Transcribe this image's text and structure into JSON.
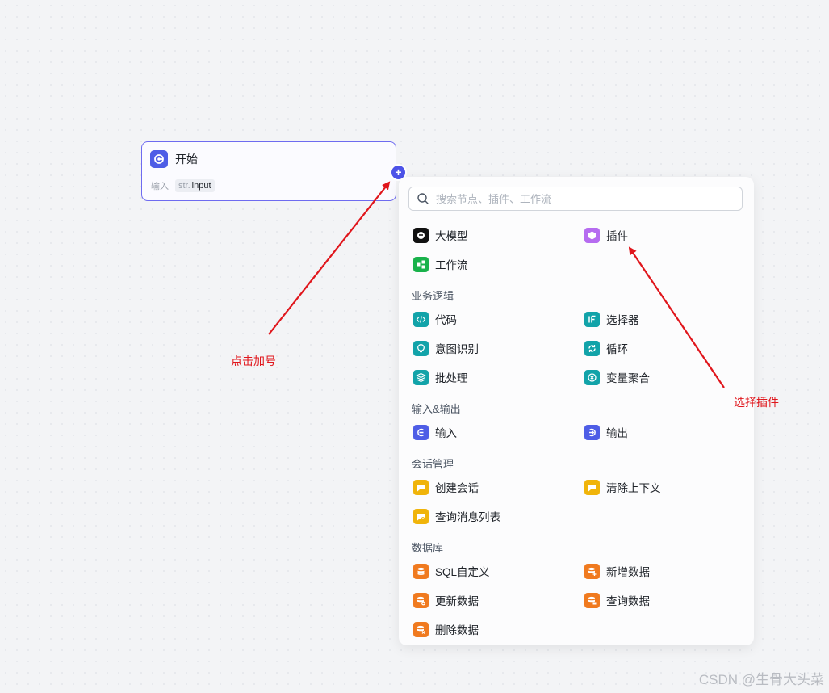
{
  "start_node": {
    "title": "开始",
    "io_label": "输入",
    "param_type": "str.",
    "param_name": "input"
  },
  "add_button": {
    "symbol": "+"
  },
  "search": {
    "placeholder": "搜索节点、插件、工作流"
  },
  "top_items": [
    {
      "label": "大模型",
      "icon": "llm-icon",
      "color": "#111111"
    },
    {
      "label": "插件",
      "icon": "plugin-icon",
      "color": "#b66cf0"
    },
    {
      "label": "工作流",
      "icon": "workflow-icon",
      "color": "#19b24b"
    }
  ],
  "sections": [
    {
      "title": "业务逻辑",
      "items": [
        {
          "label": "代码",
          "icon": "code-icon",
          "color": "#12a3a9"
        },
        {
          "label": "选择器",
          "icon": "if-selector-icon",
          "color": "#12a3a9"
        },
        {
          "label": "意图识别",
          "icon": "intent-icon",
          "color": "#12a3a9"
        },
        {
          "label": "循环",
          "icon": "loop-icon",
          "color": "#12a3a9"
        },
        {
          "label": "批处理",
          "icon": "batch-icon",
          "color": "#12a3a9"
        },
        {
          "label": "变量聚合",
          "icon": "variable-merge-icon",
          "color": "#12a3a9"
        }
      ]
    },
    {
      "title": "输入&输出",
      "items": [
        {
          "label": "输入",
          "icon": "input-icon",
          "color": "#4e5de6"
        },
        {
          "label": "输出",
          "icon": "output-icon",
          "color": "#4e5de6"
        }
      ]
    },
    {
      "title": "会话管理",
      "items": [
        {
          "label": "创建会话",
          "icon": "create-conversation-icon",
          "color": "#f0b40a"
        },
        {
          "label": "清除上下文",
          "icon": "clear-context-icon",
          "color": "#f0b40a"
        },
        {
          "label": "查询消息列表",
          "icon": "message-list-icon",
          "color": "#f0b40a"
        }
      ]
    },
    {
      "title": "数据库",
      "items": [
        {
          "label": "SQL自定义",
          "icon": "sql-icon",
          "color": "#f07a1f"
        },
        {
          "label": "新增数据",
          "icon": "add-data-icon",
          "color": "#f07a1f"
        },
        {
          "label": "更新数据",
          "icon": "update-data-icon",
          "color": "#f07a1f"
        },
        {
          "label": "查询数据",
          "icon": "query-data-icon",
          "color": "#f07a1f"
        },
        {
          "label": "删除数据",
          "icon": "delete-data-icon",
          "color": "#f07a1f"
        }
      ]
    }
  ],
  "annotations": {
    "click_plus": "点击加号",
    "select_plugin": "选择插件"
  },
  "watermark": "CSDN @生骨大头菜"
}
